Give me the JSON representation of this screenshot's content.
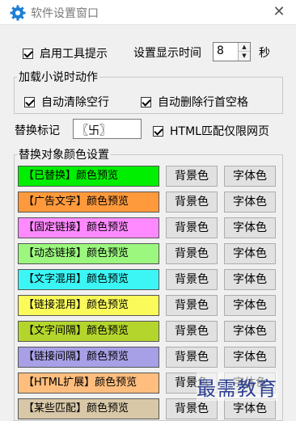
{
  "window": {
    "title": "软件设置窗口",
    "close_symbol": "✕"
  },
  "tooltip": {
    "enable_label": "启用工具提示",
    "enabled": true,
    "time_label": "设置显示时间",
    "time_value": "8",
    "unit": "秒"
  },
  "load_actions": {
    "legend": "加载小说时动作",
    "clear_blank_label": "自动清除空行",
    "clear_blank": true,
    "trim_leading_label": "自动删除行首空格",
    "trim_leading": true
  },
  "replace_mark": {
    "label": "替换标记",
    "value": "〖卐〗",
    "html_only_label": "HTML匹配仅限网页",
    "html_only": true
  },
  "color_settings": {
    "legend": "替换对象颜色设置",
    "bg_button": "背景色",
    "fg_button": "字体色",
    "items": [
      {
        "label": "【已替换】颜色预览",
        "color": "#00ee00"
      },
      {
        "label": "【广告文字】颜色预览",
        "color": "#ff9a3c"
      },
      {
        "label": "【固定链接】颜色预览",
        "color": "#ff8aff"
      },
      {
        "label": "【动态链接】颜色预览",
        "color": "#9cf77f"
      },
      {
        "label": "【文字混用】颜色预览",
        "color": "#3cf6f6"
      },
      {
        "label": "【链接混用】颜色预览",
        "color": "#fafa5a"
      },
      {
        "label": "【文字间隔】颜色预览",
        "color": "#b4d62c"
      },
      {
        "label": "【链接间隔】颜色预览",
        "color": "#a8a0e6"
      },
      {
        "label": "【HTML扩展】颜色预览",
        "color": "#ffbe7e"
      },
      {
        "label": "【某些匹配】颜色预览",
        "color": "#d8c8a8"
      }
    ]
  },
  "watermark": "最需教育"
}
